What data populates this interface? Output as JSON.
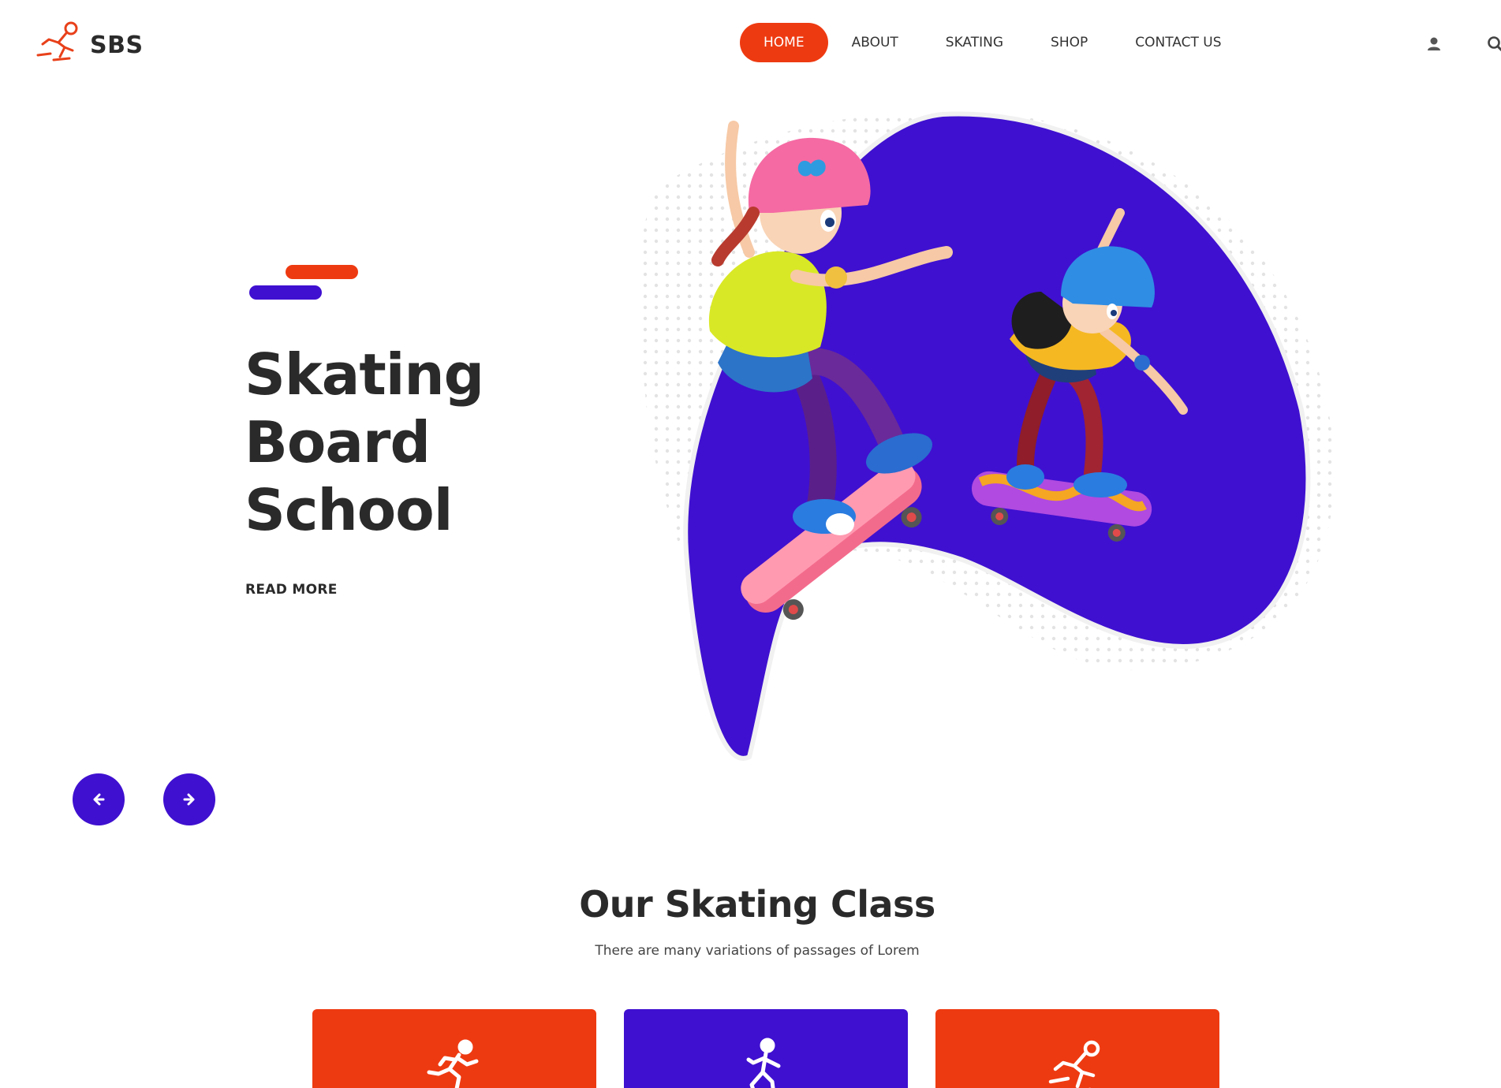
{
  "brand": {
    "name": "SBS",
    "logo_icon": "skater-logo-icon"
  },
  "nav": {
    "items": [
      {
        "label": "HOME",
        "active": true
      },
      {
        "label": "ABOUT",
        "active": false
      },
      {
        "label": "SKATING",
        "active": false
      },
      {
        "label": "SHOP",
        "active": false
      },
      {
        "label": "CONTACT US",
        "active": false
      }
    ]
  },
  "header_icons": [
    "user-icon",
    "search-icon"
  ],
  "hero": {
    "title_lines": [
      "Skating",
      "Board",
      "School"
    ],
    "read_more": "READ MORE",
    "prev_icon": "arrow-left-icon",
    "next_icon": "arrow-right-icon"
  },
  "classes": {
    "title": "Our Skating Class",
    "subtitle": "There are many variations of passages of Lorem",
    "cards": [
      {
        "icon": "runner-icon",
        "color": "#ee3a11"
      },
      {
        "icon": "skater-icon",
        "color": "#3f10d0"
      },
      {
        "icon": "speed-skater-icon",
        "color": "#ee3a11"
      }
    ]
  },
  "colors": {
    "accent_orange": "#ee3a11",
    "accent_purple": "#3f10d0",
    "text_dark": "#2a2a2a"
  }
}
